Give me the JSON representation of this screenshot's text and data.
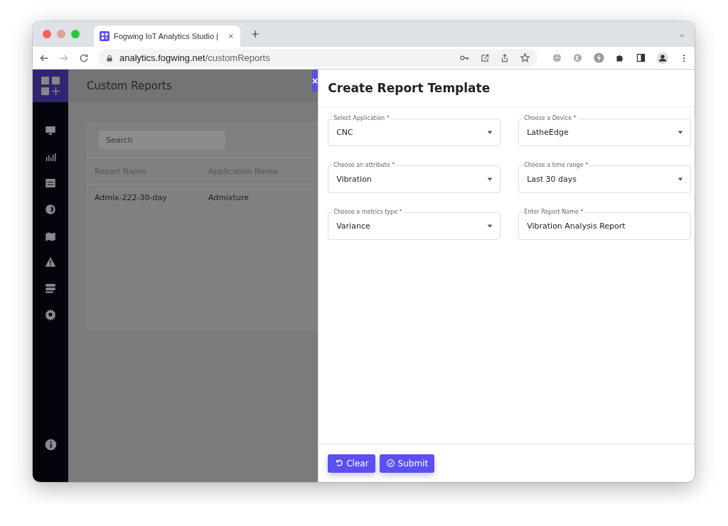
{
  "browser": {
    "tab_title": "Fogwing IoT Analytics Studio |",
    "url_domain": "analytics.fogwing.net",
    "url_path": "/customReports"
  },
  "page": {
    "title": "Custom Reports",
    "search": {
      "placeholder": "Search"
    },
    "table": {
      "columns": [
        "Report Name",
        "Application Name"
      ],
      "rows": [
        [
          "Admix-222-30-day",
          "Admixture"
        ]
      ]
    }
  },
  "drawer": {
    "title": "Create Report Template",
    "close": "×",
    "fields": [
      {
        "kind": "select",
        "label": "Select Application *",
        "value": "CNC"
      },
      {
        "kind": "select",
        "label": "Choose a Device *",
        "value": "LatheEdge"
      },
      {
        "kind": "select",
        "label": "Choose an attribute *",
        "value": "Vibration"
      },
      {
        "kind": "select",
        "label": "Choose a time range *",
        "value": "Last 30 days"
      },
      {
        "kind": "select",
        "label": "Choose a metrics type *",
        "value": "Variance"
      },
      {
        "kind": "text",
        "label": "Enter Report Name *",
        "value": "Vibration Analysis Report"
      }
    ],
    "buttons": [
      {
        "kind": "clear",
        "label": "Clear"
      },
      {
        "kind": "submit",
        "label": "Submit"
      }
    ]
  }
}
